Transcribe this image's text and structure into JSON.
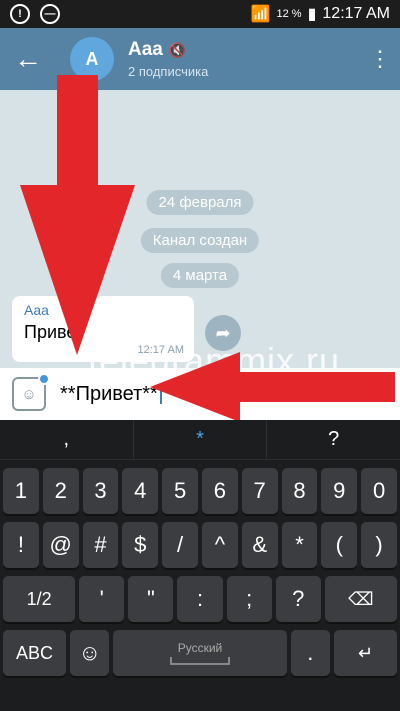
{
  "status_bar": {
    "battery": "12 %",
    "time": "12:17 AM"
  },
  "header": {
    "back": "←",
    "avatar_letter": "A",
    "title": "Aaa",
    "subtitle": "2 подписчика",
    "menu": "⋮"
  },
  "chat": {
    "dates": [
      "24 февраля",
      "Канал создан",
      "4 марта"
    ],
    "message": {
      "author": "Aaa",
      "text": "Привет",
      "time": "12:17 AM"
    },
    "watermark": "telegrammix.ru"
  },
  "input": {
    "text": "**Привет**"
  },
  "keyboard": {
    "suggestions": [
      ",",
      "*",
      "?"
    ],
    "row1": [
      "1",
      "2",
      "3",
      "4",
      "5",
      "6",
      "7",
      "8",
      "9",
      "0"
    ],
    "row2": [
      "!",
      "@",
      "#",
      "$",
      "/",
      "^",
      "&",
      "*",
      "(",
      ")"
    ],
    "row3": [
      "1/2",
      "'",
      "\"",
      ":",
      ";",
      "?",
      "⌫"
    ],
    "row4": [
      "ABC",
      "☺",
      "Русский",
      ".",
      "↵"
    ]
  },
  "colors": {
    "header": "#5682a3",
    "arrow": "#e3262a",
    "keyboard": "#1c1d1f"
  }
}
